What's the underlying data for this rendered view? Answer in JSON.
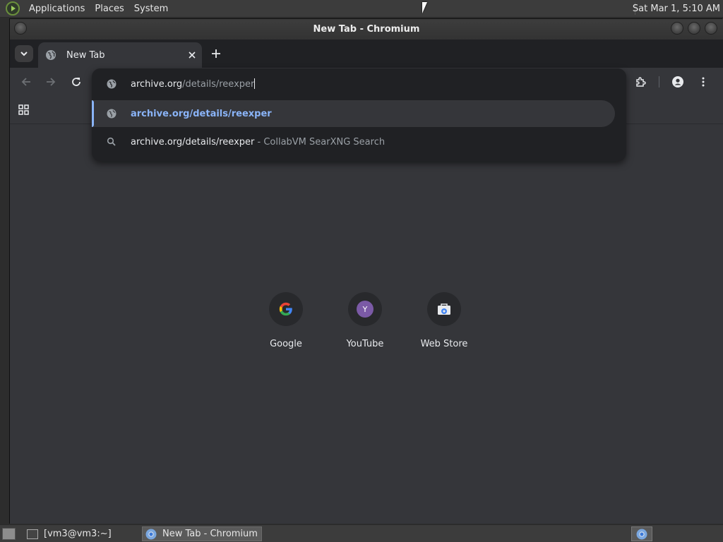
{
  "top_panel": {
    "menus": [
      "Applications",
      "Places",
      "System"
    ],
    "clock": "Sat Mar 1, 5:10 AM"
  },
  "window": {
    "title": "New Tab - Chromium"
  },
  "tabs": [
    {
      "title": "New Tab",
      "active": true
    }
  ],
  "omnibox": {
    "input": {
      "domain": "archive.org",
      "path": "/details/reexper"
    },
    "suggestions": [
      {
        "text": "archive.org/details/reexper",
        "suffix": "",
        "icon": "globe-icon",
        "selected": true
      },
      {
        "text": "archive.org/details/reexper",
        "suffix": " - CollabVM SearXNG Search",
        "icon": "search-icon",
        "selected": false
      }
    ]
  },
  "shortcuts": [
    {
      "label": "Google",
      "icon": "google-icon"
    },
    {
      "label": "YouTube",
      "icon": "youtube-avatar",
      "letter": "Y"
    },
    {
      "label": "Web Store",
      "icon": "webstore-icon"
    }
  ],
  "taskbar": {
    "items": [
      {
        "label": "[vm3@vm3:~]",
        "icon": "terminal-icon",
        "active": false
      },
      {
        "label": "New Tab - Chromium",
        "icon": "chromium-icon",
        "active": true
      }
    ]
  },
  "colors": {
    "accent": "#8ab4f8",
    "toolbar": "#35363a",
    "frame": "#202124"
  }
}
